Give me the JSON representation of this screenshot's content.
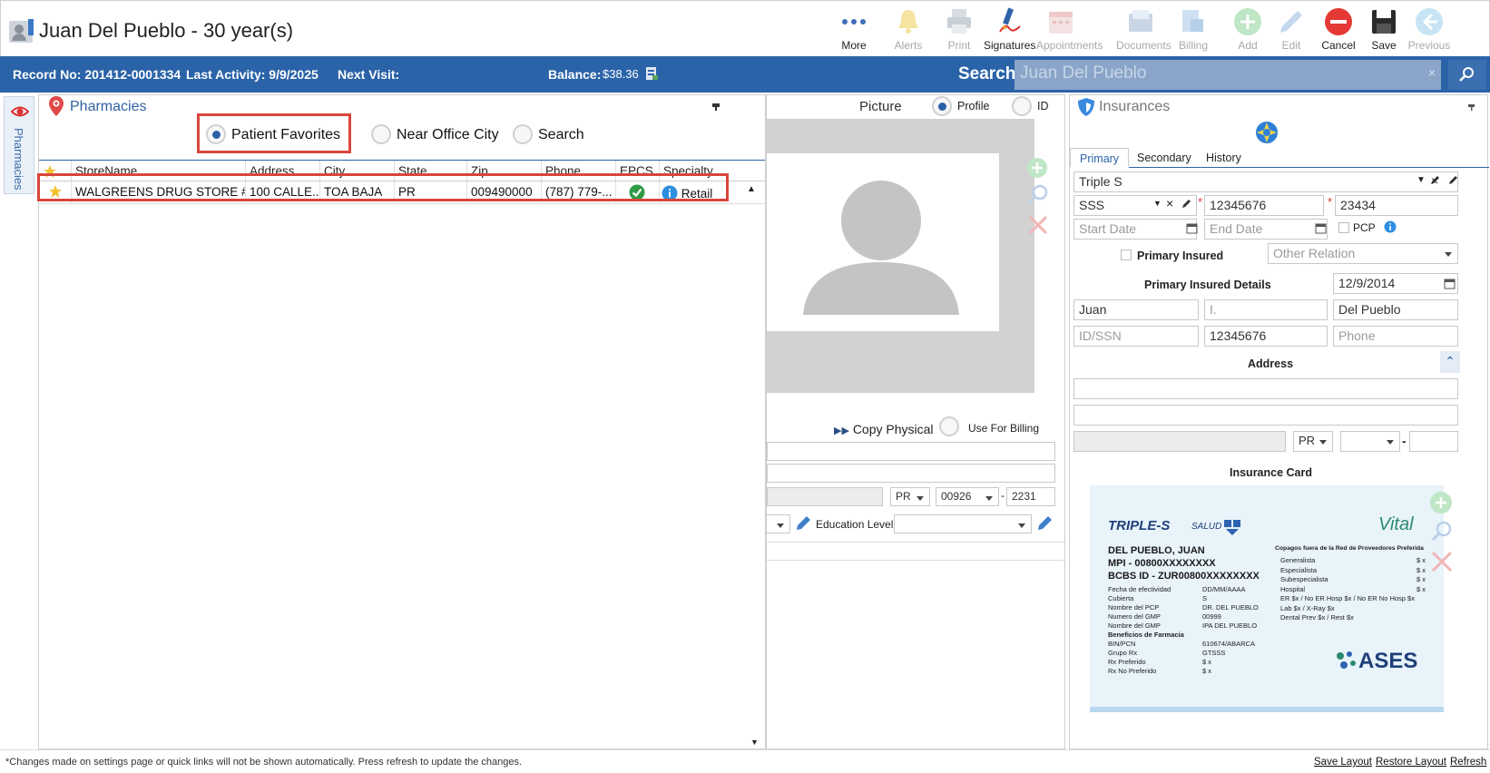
{
  "header": {
    "patient_title": "Juan Del Pueblo - 30 year(s)"
  },
  "toolbar": [
    {
      "label": "More",
      "icon": "more-icon",
      "enabled": true
    },
    {
      "label": "Alerts",
      "icon": "bell-icon",
      "enabled": false
    },
    {
      "label": "Print",
      "icon": "printer-icon",
      "enabled": false
    },
    {
      "label": "Signatures",
      "icon": "signature-icon",
      "enabled": true
    },
    {
      "label": "Appointments",
      "icon": "calendar-icon",
      "enabled": false
    },
    {
      "label": "Documents",
      "icon": "documents-icon",
      "enabled": false
    },
    {
      "label": "Billing",
      "icon": "billing-icon",
      "enabled": false
    },
    {
      "label": "Add",
      "icon": "add-icon",
      "enabled": false
    },
    {
      "label": "Edit",
      "icon": "pencil-icon",
      "enabled": false
    },
    {
      "label": "Cancel",
      "icon": "cancel-icon",
      "enabled": true
    },
    {
      "label": "Save",
      "icon": "save-icon",
      "enabled": true
    },
    {
      "label": "Previous",
      "icon": "previous-icon",
      "enabled": false
    }
  ],
  "infobar": {
    "record": "Record No: 201412-0001334",
    "last_activity": "Last Activity: 9/9/2025",
    "next_visit": "Next Visit:",
    "balance_label": "Balance:",
    "balance_value": "$38.36",
    "search_label": "Search:",
    "search_value": "Juan Del Pueblo",
    "search_clear": "×"
  },
  "side_strip": {
    "label": "Pharmacies"
  },
  "pharmacies": {
    "title": "Pharmacies",
    "filters": [
      {
        "label": "Patient Favorites",
        "selected": true
      },
      {
        "label": "Near Office City",
        "selected": false
      },
      {
        "label": "Search",
        "selected": false
      }
    ],
    "columns": [
      "StoreName",
      "Address",
      "City",
      "State",
      "Zip",
      "Phone",
      "EPCS",
      "Specialty"
    ],
    "rows": [
      {
        "store": "WALGREENS DRUG STORE #...",
        "address": "100 CALLE...",
        "city": "TOA BAJA",
        "state": "PR",
        "zip": "009490000",
        "phone": "(787) 779-...",
        "specialty": "Retail"
      }
    ]
  },
  "picture": {
    "title": "Picture",
    "options": [
      {
        "label": "Profile",
        "selected": true
      },
      {
        "label": "ID",
        "selected": false
      }
    ],
    "copy_physical": "Copy Physical",
    "use_for_billing": "Use For Billing",
    "state": "PR",
    "zip": "00926",
    "zip_dash": "-",
    "zip_ext": "2231",
    "education_label": "Education Level:"
  },
  "insurances": {
    "title": "Insurances",
    "tabs": [
      "Primary",
      "Secondary",
      "History"
    ],
    "plan": "Triple S",
    "type": "SSS",
    "policy_no": "12345676",
    "group_no": "23434",
    "start_date_placeholder": "Start Date",
    "end_date_placeholder": "End Date",
    "pcp_label": "PCP",
    "primary_insured_label": "Primary Insured",
    "other_relation_placeholder": "Other Relation",
    "details_label": "Primary Insured Details",
    "dob": "12/9/2014",
    "first_name": "Juan",
    "middle_initial": "I.",
    "last_name": "Del Pueblo",
    "id_ssn_placeholder": "ID/SSN",
    "member_id": "12345676",
    "phone_placeholder": "Phone",
    "address_label": "Address",
    "state": "PR",
    "zip_dash": "-",
    "card_label": "Insurance Card",
    "card": {
      "brand": "TRIPLE-S",
      "brand_sub": "SALUD",
      "vital": "Vital",
      "name": "DEL PUEBLO, JUAN",
      "mpi": "MPI - 00800XXXXXXXX",
      "bcbs": "BCBS ID - ZUR00800XXXXXXXX",
      "left_labels": [
        "Fecha de efectividad",
        "Cubierta",
        "Nombre del PCP",
        "Numero del GMP",
        "Nombre del GMP",
        "Beneficios de Farmacia",
        "BIN/PCN",
        "Grupo Rx",
        "Rx Preferido",
        "Rx No Preferido"
      ],
      "left_values": [
        "DD/MM/AAAA",
        "S",
        "DR. DEL PUEBLO",
        "00999",
        "IPA DEL PUEBLO",
        "",
        "610674/ABARCA",
        "GTSSS",
        "$ x",
        "$ x"
      ],
      "right_title": "Copagos fuera de la Red de Proveedores Preferida",
      "right_labels": [
        "Generalista",
        "Especialista",
        "Subespecialista",
        "Hospital",
        "ER $x / No ER Hosp $x / No ER No Hosp $x",
        "Lab $x / X-Ray $x",
        "Dental Prev $x / Rest $x"
      ],
      "right_values": [
        "$ x",
        "$ x",
        "$ x",
        "$ x",
        "",
        "",
        ""
      ],
      "ases": "ASES"
    }
  },
  "footer": {
    "note": "*Changes made on settings page or quick links will not be shown automatically. Press refresh to update the changes.",
    "save_layout": "Save Layout",
    "restore_layout": "Restore Layout",
    "refresh": "Refresh"
  },
  "colors": {
    "accent": "#2b63a8",
    "highlight": "#d9453b",
    "success": "#2e9b46"
  }
}
